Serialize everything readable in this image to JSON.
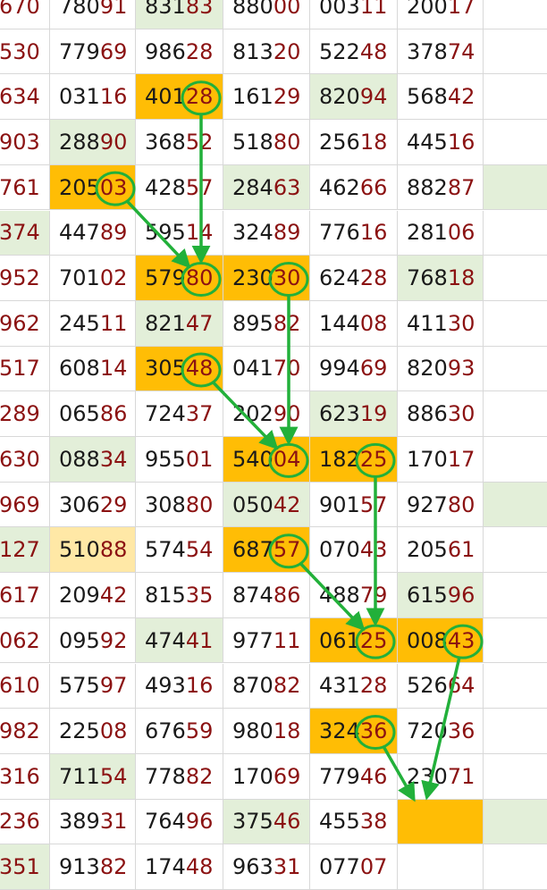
{
  "colors": {
    "highlight_orange": "#ffbd05",
    "highlight_green": "#e3efd9",
    "highlight_yellow": "#ffe8a6",
    "suffix_red": "#8b1212",
    "annotation_green": "#22b03a"
  },
  "rows": [
    [
      {
        "p": "",
        "s": "670"
      },
      {
        "p": "780",
        "s": "91"
      },
      {
        "p": "831",
        "s": "83",
        "h": "green"
      },
      {
        "p": "880",
        "s": "00"
      },
      {
        "p": "003",
        "s": "11"
      },
      {
        "p": "200",
        "s": "17"
      },
      {
        "p": "",
        "s": ""
      }
    ],
    [
      {
        "p": "",
        "s": "530"
      },
      {
        "p": "779",
        "s": "69"
      },
      {
        "p": "986",
        "s": "28"
      },
      {
        "p": "813",
        "s": "20"
      },
      {
        "p": "522",
        "s": "48"
      },
      {
        "p": "378",
        "s": "74"
      },
      {
        "p": "",
        "s": ""
      }
    ],
    [
      {
        "p": "",
        "s": "634"
      },
      {
        "p": "031",
        "s": "16"
      },
      {
        "p": "401",
        "s": "28",
        "h": "orange"
      },
      {
        "p": "161",
        "s": "29"
      },
      {
        "p": "820",
        "s": "94",
        "h": "green"
      },
      {
        "p": "568",
        "s": "42"
      },
      {
        "p": "",
        "s": ""
      }
    ],
    [
      {
        "p": "",
        "s": "903"
      },
      {
        "p": "288",
        "s": "90",
        "h": "green"
      },
      {
        "p": "368",
        "s": "52"
      },
      {
        "p": "518",
        "s": "80"
      },
      {
        "p": "256",
        "s": "18"
      },
      {
        "p": "445",
        "s": "16"
      },
      {
        "p": "",
        "s": ""
      }
    ],
    [
      {
        "p": "",
        "s": "761"
      },
      {
        "p": "205",
        "s": "03",
        "h": "orange"
      },
      {
        "p": "428",
        "s": "57"
      },
      {
        "p": "284",
        "s": "63",
        "h": "green"
      },
      {
        "p": "462",
        "s": "66"
      },
      {
        "p": "882",
        "s": "87"
      },
      {
        "p": "",
        "s": "",
        "h": "green"
      }
    ],
    [
      {
        "p": "",
        "s": "374",
        "h": "green"
      },
      {
        "p": "447",
        "s": "89"
      },
      {
        "p": "595",
        "s": "14"
      },
      {
        "p": "324",
        "s": "89"
      },
      {
        "p": "776",
        "s": "16"
      },
      {
        "p": "281",
        "s": "06"
      },
      {
        "p": "",
        "s": ""
      }
    ],
    [
      {
        "p": "",
        "s": "952"
      },
      {
        "p": "701",
        "s": "02"
      },
      {
        "p": "579",
        "s": "80",
        "h": "orange"
      },
      {
        "p": "230",
        "s": "30",
        "h": "orange"
      },
      {
        "p": "624",
        "s": "28"
      },
      {
        "p": "768",
        "s": "18",
        "h": "green"
      },
      {
        "p": "",
        "s": ""
      }
    ],
    [
      {
        "p": "",
        "s": "962"
      },
      {
        "p": "245",
        "s": "11"
      },
      {
        "p": "821",
        "s": "47",
        "h": "green"
      },
      {
        "p": "895",
        "s": "82"
      },
      {
        "p": "144",
        "s": "08"
      },
      {
        "p": "411",
        "s": "30"
      },
      {
        "p": "",
        "s": ""
      }
    ],
    [
      {
        "p": "",
        "s": "517"
      },
      {
        "p": "608",
        "s": "14"
      },
      {
        "p": "305",
        "s": "48",
        "h": "orange"
      },
      {
        "p": "041",
        "s": "70"
      },
      {
        "p": "994",
        "s": "69"
      },
      {
        "p": "820",
        "s": "93"
      },
      {
        "p": "",
        "s": ""
      }
    ],
    [
      {
        "p": "",
        "s": "289"
      },
      {
        "p": "065",
        "s": "86"
      },
      {
        "p": "724",
        "s": "37"
      },
      {
        "p": "202",
        "s": "90"
      },
      {
        "p": "623",
        "s": "19",
        "h": "green"
      },
      {
        "p": "886",
        "s": "30"
      },
      {
        "p": "",
        "s": ""
      }
    ],
    [
      {
        "p": "",
        "s": "630"
      },
      {
        "p": "088",
        "s": "34",
        "h": "green"
      },
      {
        "p": "955",
        "s": "01"
      },
      {
        "p": "540",
        "s": "04",
        "h": "orange"
      },
      {
        "p": "182",
        "s": "25",
        "h": "orange"
      },
      {
        "p": "170",
        "s": "17"
      },
      {
        "p": "",
        "s": ""
      }
    ],
    [
      {
        "p": "",
        "s": "969"
      },
      {
        "p": "306",
        "s": "29"
      },
      {
        "p": "308",
        "s": "80"
      },
      {
        "p": "050",
        "s": "42",
        "h": "green"
      },
      {
        "p": "901",
        "s": "57"
      },
      {
        "p": "927",
        "s": "80"
      },
      {
        "p": "",
        "s": "",
        "h": "green"
      }
    ],
    [
      {
        "p": "",
        "s": "127",
        "h": "green"
      },
      {
        "p": "510",
        "s": "88",
        "h": "yellow"
      },
      {
        "p": "574",
        "s": "54"
      },
      {
        "p": "687",
        "s": "57",
        "h": "orange"
      },
      {
        "p": "070",
        "s": "43"
      },
      {
        "p": "205",
        "s": "61"
      },
      {
        "p": "",
        "s": ""
      }
    ],
    [
      {
        "p": "",
        "s": "617"
      },
      {
        "p": "209",
        "s": "42"
      },
      {
        "p": "815",
        "s": "35"
      },
      {
        "p": "874",
        "s": "86"
      },
      {
        "p": "488",
        "s": "79"
      },
      {
        "p": "615",
        "s": "96",
        "h": "green"
      },
      {
        "p": "",
        "s": ""
      }
    ],
    [
      {
        "p": "",
        "s": "062"
      },
      {
        "p": "095",
        "s": "92"
      },
      {
        "p": "474",
        "s": "41",
        "h": "green"
      },
      {
        "p": "977",
        "s": "11"
      },
      {
        "p": "061",
        "s": "25",
        "h": "orange"
      },
      {
        "p": "008",
        "s": "43",
        "h": "orange"
      },
      {
        "p": "",
        "s": ""
      }
    ],
    [
      {
        "p": "",
        "s": "610"
      },
      {
        "p": "575",
        "s": "97"
      },
      {
        "p": "493",
        "s": "16"
      },
      {
        "p": "870",
        "s": "82"
      },
      {
        "p": "431",
        "s": "28"
      },
      {
        "p": "526",
        "s": "64"
      },
      {
        "p": "",
        "s": ""
      }
    ],
    [
      {
        "p": "",
        "s": "982"
      },
      {
        "p": "225",
        "s": "08"
      },
      {
        "p": "676",
        "s": "59"
      },
      {
        "p": "980",
        "s": "18"
      },
      {
        "p": "324",
        "s": "36",
        "h": "orange"
      },
      {
        "p": "720",
        "s": "36"
      },
      {
        "p": "",
        "s": ""
      }
    ],
    [
      {
        "p": "",
        "s": "316"
      },
      {
        "p": "711",
        "s": "54",
        "h": "green"
      },
      {
        "p": "778",
        "s": "82"
      },
      {
        "p": "170",
        "s": "69"
      },
      {
        "p": "779",
        "s": "46"
      },
      {
        "p": "230",
        "s": "71"
      },
      {
        "p": "",
        "s": ""
      }
    ],
    [
      {
        "p": "",
        "s": "236"
      },
      {
        "p": "389",
        "s": "31"
      },
      {
        "p": "764",
        "s": "96"
      },
      {
        "p": "375",
        "s": "46",
        "h": "green"
      },
      {
        "p": "455",
        "s": "38"
      },
      {
        "p": "",
        "s": "",
        "h": "orange"
      },
      {
        "p": "",
        "s": "",
        "h": "green"
      }
    ],
    [
      {
        "p": "",
        "s": "351",
        "h": "green"
      },
      {
        "p": "913",
        "s": "82"
      },
      {
        "p": "174",
        "s": "48"
      },
      {
        "p": "963",
        "s": "31"
      },
      {
        "p": "077",
        "s": "07"
      },
      {
        "p": "",
        "s": ""
      },
      {
        "p": "",
        "s": ""
      }
    ]
  ],
  "circled_cells": [
    [
      2,
      2
    ],
    [
      4,
      1
    ],
    [
      6,
      2
    ],
    [
      6,
      3
    ],
    [
      8,
      2
    ],
    [
      10,
      3
    ],
    [
      10,
      4
    ],
    [
      12,
      3
    ],
    [
      14,
      4
    ],
    [
      14,
      5
    ],
    [
      16,
      4
    ]
  ],
  "arrows": [
    {
      "from": [
        2,
        2
      ],
      "to": [
        6,
        2
      ]
    },
    {
      "from": [
        4,
        1
      ],
      "to": [
        6,
        2
      ]
    },
    {
      "from": [
        6,
        3
      ],
      "to": [
        10,
        3
      ]
    },
    {
      "from": [
        8,
        2
      ],
      "to": [
        10,
        3
      ]
    },
    {
      "from": [
        10,
        4
      ],
      "to": [
        14,
        4
      ]
    },
    {
      "from": [
        12,
        3
      ],
      "to": [
        14,
        4
      ]
    },
    {
      "from": [
        14,
        5
      ],
      "to": [
        18,
        5
      ]
    },
    {
      "from": [
        16,
        4
      ],
      "to": [
        18,
        5
      ]
    }
  ]
}
